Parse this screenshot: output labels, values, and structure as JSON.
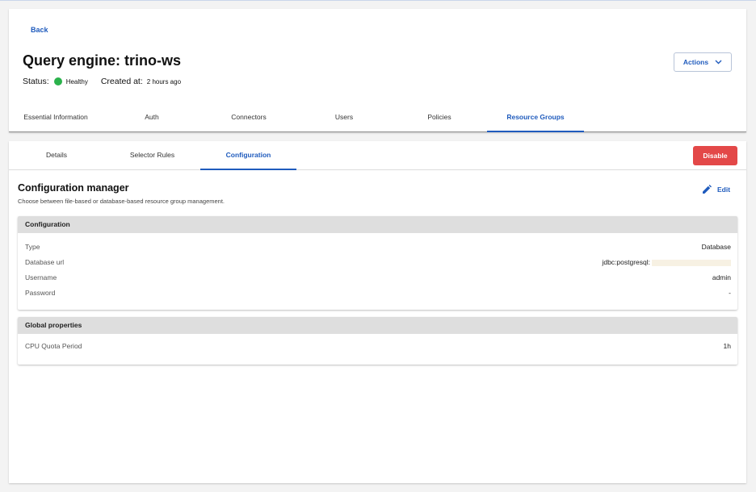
{
  "header": {
    "back_label": "Back",
    "title": "Query engine: trino-ws",
    "status_label": "Status:",
    "status_value": "Healthy",
    "status_color": "#2bb24c",
    "created_label": "Created at:",
    "created_value": "2 hours ago",
    "actions_label": "Actions"
  },
  "main_tabs": [
    {
      "label": "Essential Information",
      "active": false
    },
    {
      "label": "Auth",
      "active": false
    },
    {
      "label": "Connectors",
      "active": false
    },
    {
      "label": "Users",
      "active": false
    },
    {
      "label": "Policies",
      "active": false
    },
    {
      "label": "Resource Groups",
      "active": true
    }
  ],
  "sub_tabs": [
    {
      "label": "Details",
      "active": false
    },
    {
      "label": "Selector Rules",
      "active": false
    },
    {
      "label": "Configuration",
      "active": true
    }
  ],
  "disable_label": "Disable",
  "config_manager": {
    "title": "Configuration manager",
    "description": "Choose between file-based or database-based resource group management.",
    "edit_label": "Edit"
  },
  "configuration_panel": {
    "header": "Configuration",
    "rows": [
      {
        "key": "Type",
        "value": "Database"
      },
      {
        "key": "Database url",
        "value": "jdbc:postgresql:"
      },
      {
        "key": "Username",
        "value": "admin"
      },
      {
        "key": "Password",
        "value": "-"
      }
    ]
  },
  "global_panel": {
    "header": "Global properties",
    "rows": [
      {
        "key": "CPU Quota Period",
        "value": "1h"
      }
    ]
  },
  "colors": {
    "accent": "#1f5bbd",
    "danger": "#e34848",
    "healthy": "#2bb24c"
  }
}
